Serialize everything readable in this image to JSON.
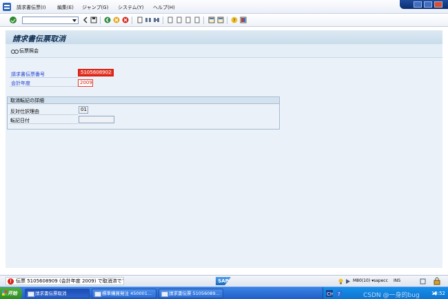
{
  "menubar": {
    "items": [
      "請求書伝票(I)",
      "編集(E)",
      "ジャンプ(G)",
      "システム(Y)",
      "ヘルプ(H)"
    ]
  },
  "title": "請求書伝票取消",
  "apptoolbar": {
    "display_button": "伝票照会"
  },
  "form": {
    "invoice_label": "請求書伝票番号",
    "invoice_value": "5105608902",
    "year_label": "会計年度",
    "year_value": "2009"
  },
  "reversal_group": {
    "title": "取消転記の詳細",
    "reason_label": "反対仕訳理由",
    "reason_value": "01",
    "posting_date_label": "転記日付",
    "posting_date_value": ""
  },
  "statusbar": {
    "message": "伝票 5105608909 (会計年度 2009) で取消済です",
    "sap_logo": "SAP",
    "system": "M80(10)",
    "client_user": "sapecc",
    "mode": "INS"
  },
  "taskbar": {
    "start": "开始",
    "tasks": [
      "請求書伝票取消",
      "標準購買発注 450001...",
      "請求書伝票 51056089..."
    ],
    "clock": "19:52"
  },
  "watermark": "CSDN @一身的bug"
}
